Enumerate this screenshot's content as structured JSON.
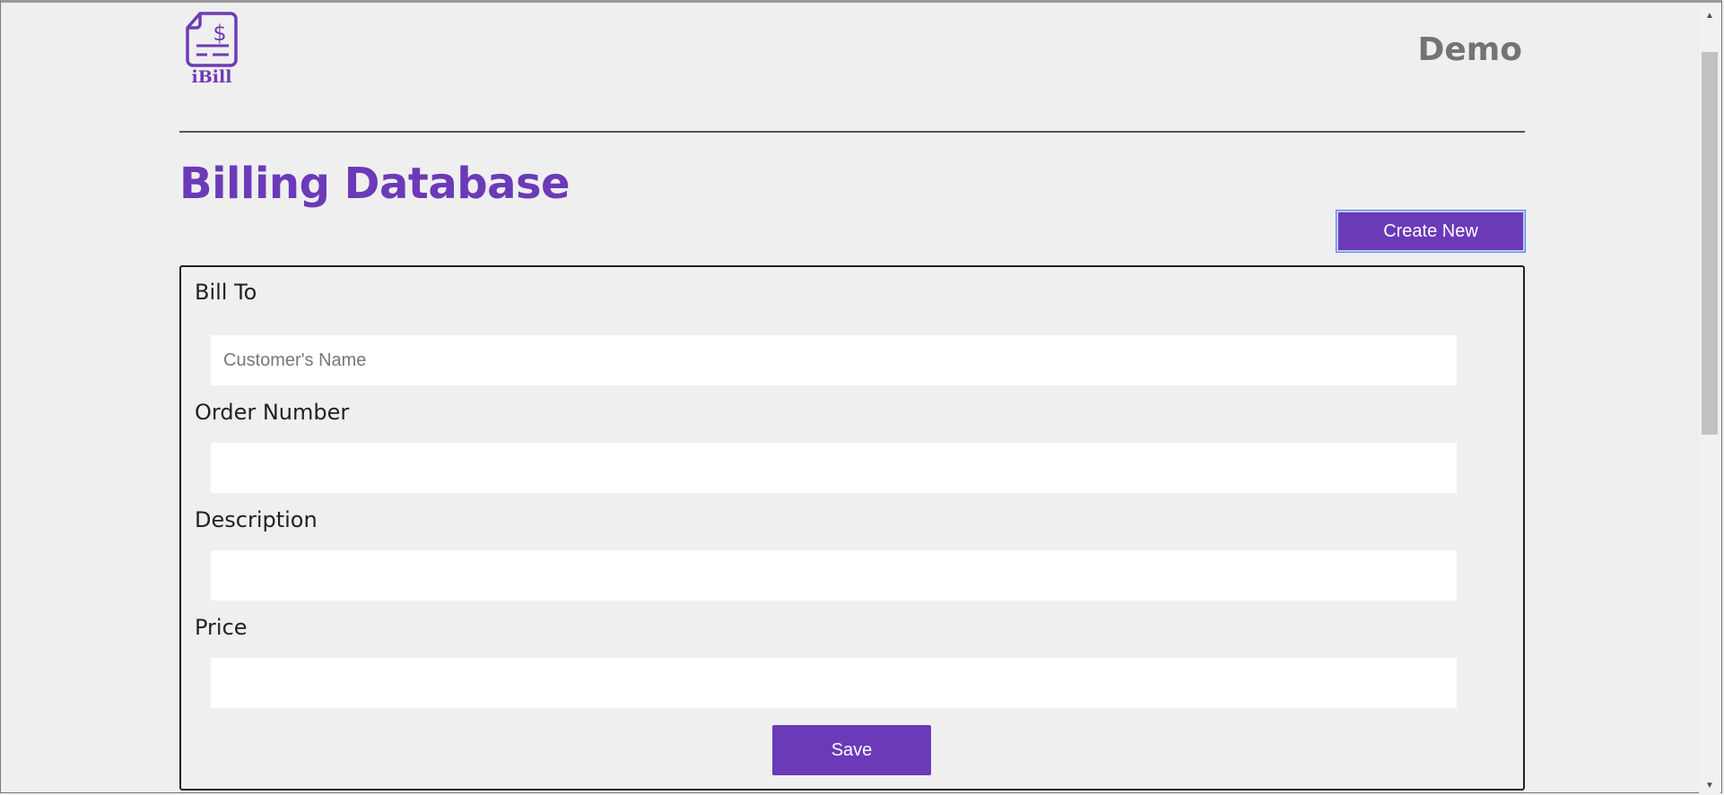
{
  "header": {
    "logo_text": "iBill",
    "user_name": "Demo"
  },
  "page": {
    "title": "Billing Database",
    "create_label": "Create New"
  },
  "form": {
    "fields": [
      {
        "label": "Bill To",
        "value": "",
        "placeholder": "Customer's Name"
      },
      {
        "label": "Order Number",
        "value": "",
        "placeholder": ""
      },
      {
        "label": "Description",
        "value": "",
        "placeholder": ""
      },
      {
        "label": "Price",
        "value": "",
        "placeholder": ""
      }
    ],
    "save_label": "Save"
  },
  "icons": {
    "logo": "invoice-dollar-icon",
    "scroll_up": "scroll-up-arrow-icon",
    "scroll_down": "scroll-down-arrow-icon"
  },
  "colors": {
    "brand_purple": "#6a3ab9",
    "background": "#efefef"
  }
}
